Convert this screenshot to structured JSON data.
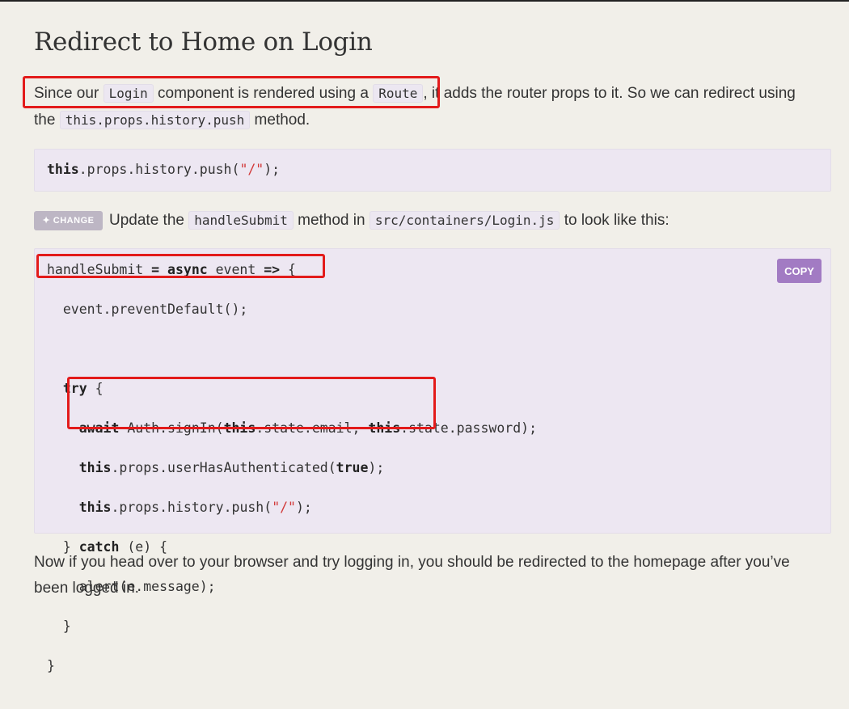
{
  "prev_fragment": {
    "text_before": "…",
    "code": "…"
  },
  "heading": "Redirect to Home on Login",
  "para1": {
    "t1": "Since our",
    "c1": "Login",
    "t2": "component is rendered using a",
    "c2": "Route",
    "t3": ", it adds the router props to it. So we can redirect using",
    "t4": "the",
    "c3": "this.props.history.push",
    "t5": "method."
  },
  "code1": {
    "kw": "this",
    "mid": ".props.history.push(",
    "str": "\"/\"",
    "end": ");"
  },
  "change": {
    "badge_label": "✦ CHANGE",
    "t1": "Update the",
    "c1": "handleSubmit",
    "t2": "method in",
    "c2": "src/containers/Login.js",
    "t3": "to look like this:"
  },
  "copy_label": "COPY",
  "code2": {
    "l1a": "handleSubmit ",
    "l1b": "=",
    "l1c": " ",
    "l1d": "async",
    "l1e": " event ",
    "l1f": "=>",
    "l1g": " {",
    "l2": "  event.preventDefault();",
    "l4a": "  ",
    "l4b": "try",
    "l4c": " {",
    "l5a": "    ",
    "l5b": "await",
    "l5c": " Auth.signIn(",
    "l5d": "this",
    "l5e": ".state.email, ",
    "l5f": "this",
    "l5g": ".state.password);",
    "l6a": "    ",
    "l6b": "this",
    "l6c": ".props.userHasAuthenticated(",
    "l6d": "true",
    "l6e": ");",
    "l7a": "    ",
    "l7b": "this",
    "l7c": ".props.history.push(",
    "l7d": "\"/\"",
    "l7e": ");",
    "l8a": "  } ",
    "l8b": "catch",
    "l8c": " (e) {",
    "l9": "    alert(e.message);",
    "l10": "  }",
    "l11": "}"
  },
  "para_final": {
    "line1": "Now if you head over to your browser and try logging in, you should be redirected to the homepage after you’ve",
    "line2": "been logged in."
  },
  "colors": {
    "highlight": "#e31b1b",
    "copy_button": "#a27bc3",
    "code_bg": "#ede7f2",
    "page_bg": "#f1efe9"
  }
}
